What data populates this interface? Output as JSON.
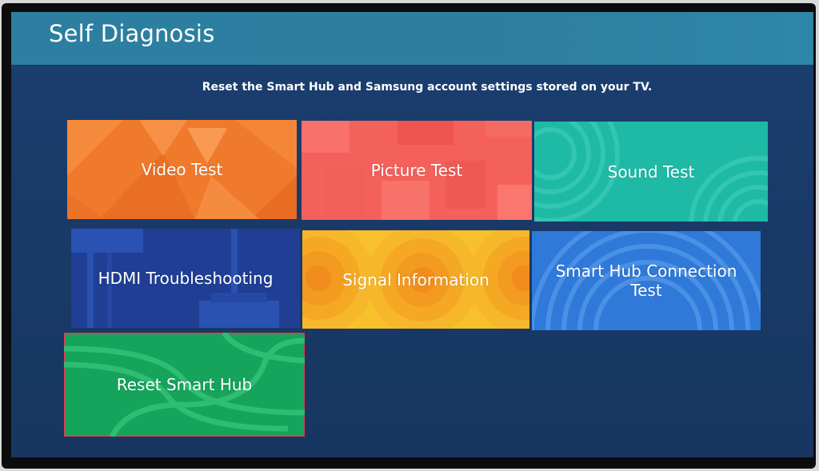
{
  "header": {
    "title": "Self Diagnosis"
  },
  "description": "Reset the Smart Hub and Samsung account settings stored on your TV.",
  "tiles": [
    {
      "label": "Video Test"
    },
    {
      "label": "Picture Test"
    },
    {
      "label": "Sound Test"
    },
    {
      "label": "HDMI Troubleshooting"
    },
    {
      "label": "Signal Information"
    },
    {
      "label": "Smart Hub Connection Test"
    },
    {
      "label": "Reset Smart Hub"
    }
  ],
  "focused_tile": "Reset Smart Hub",
  "colors": {
    "header": "#2d7f9f",
    "screen_background": "#1a3c6b",
    "video_test": "#f07a2c",
    "picture_test": "#f4605a",
    "sound_test": "#1ebaa6",
    "hdmi_troubleshooting": "#1f3e94",
    "signal_information": "#f6c12a",
    "smart_hub_connection_test": "#2f79d8",
    "reset_smart_hub": "#16a35c",
    "focus_border": "#d64550"
  }
}
